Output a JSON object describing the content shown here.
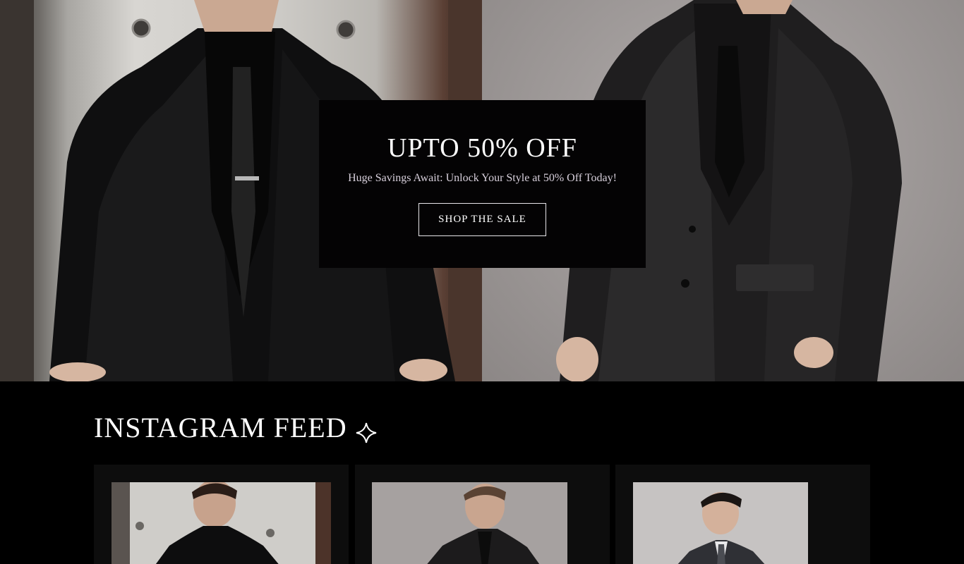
{
  "hero": {
    "sale_title": "UPTO 50% OFF",
    "sale_subtitle": "Huge Savings Await: Unlock Your Style at 50% Off Today!",
    "sale_button": "SHOP THE SALE"
  },
  "instagram": {
    "title": "INSTAGRAM FEED",
    "icon": "sparkle-icon"
  },
  "colors": {
    "background": "#000000",
    "sale_box": "#040304",
    "card_background": "#0d0d0d",
    "text": "#ffffff"
  }
}
